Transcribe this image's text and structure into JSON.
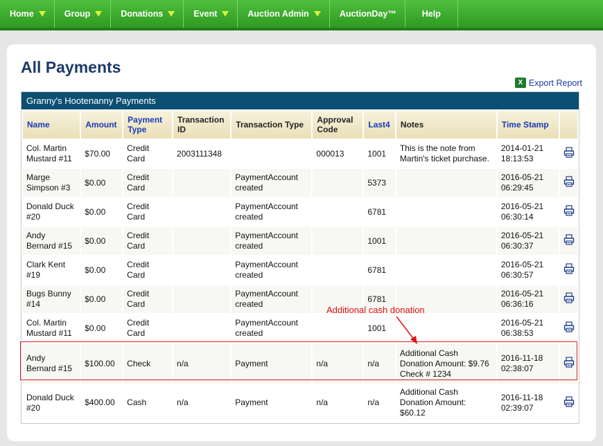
{
  "nav": {
    "items": [
      {
        "label": "Home",
        "dropdown": true
      },
      {
        "label": "Group",
        "dropdown": true
      },
      {
        "label": "Donations",
        "dropdown": true
      },
      {
        "label": "Event",
        "dropdown": true
      },
      {
        "label": "Auction Admin",
        "dropdown": true
      },
      {
        "label": "AuctionDay™",
        "dropdown": false
      },
      {
        "label": "Help",
        "dropdown": false
      }
    ]
  },
  "page": {
    "title": "All Payments",
    "export_label": "Export Report"
  },
  "table": {
    "title": "Granny's Hootenanny Payments",
    "headers": [
      {
        "label": "Name",
        "sortable": true
      },
      {
        "label": "Amount",
        "sortable": true
      },
      {
        "label": "Payment Type",
        "sortable": true
      },
      {
        "label": "Transaction ID",
        "sortable": false
      },
      {
        "label": "Transaction Type",
        "sortable": false
      },
      {
        "label": "Approval Code",
        "sortable": false
      },
      {
        "label": "Last4",
        "sortable": true
      },
      {
        "label": "Notes",
        "sortable": false
      },
      {
        "label": "Time Stamp",
        "sortable": true
      }
    ],
    "rows": [
      {
        "name": "Col. Martin Mustard #11",
        "amount": "$70.00",
        "payment_type": "Credit Card",
        "transaction_id": "2003111348",
        "transaction_type": "",
        "approval_code": "000013",
        "last4": "1001",
        "notes": "This is the note from Martin's ticket purchase.",
        "time_stamp": "2014-01-21 18:13:53"
      },
      {
        "name": "Marge Simpson #3",
        "amount": "$0.00",
        "payment_type": "Credit Card",
        "transaction_id": "",
        "transaction_type": "PaymentAccount created",
        "approval_code": "",
        "last4": "5373",
        "notes": "",
        "time_stamp": "2016-05-21 06:29:45"
      },
      {
        "name": "Donald Duck #20",
        "amount": "$0.00",
        "payment_type": "Credit Card",
        "transaction_id": "",
        "transaction_type": "PaymentAccount created",
        "approval_code": "",
        "last4": "6781",
        "notes": "",
        "time_stamp": "2016-05-21 06:30:14"
      },
      {
        "name": "Andy Bernard #15",
        "amount": "$0.00",
        "payment_type": "Credit Card",
        "transaction_id": "",
        "transaction_type": "PaymentAccount created",
        "approval_code": "",
        "last4": "1001",
        "notes": "",
        "time_stamp": "2016-05-21 06:30:37"
      },
      {
        "name": "Clark Kent #19",
        "amount": "$0.00",
        "payment_type": "Credit Card",
        "transaction_id": "",
        "transaction_type": "PaymentAccount created",
        "approval_code": "",
        "last4": "6781",
        "notes": "",
        "time_stamp": "2016-05-21 06:30:57"
      },
      {
        "name": "Bugs Bunny #14",
        "amount": "$0.00",
        "payment_type": "Credit Card",
        "transaction_id": "",
        "transaction_type": "PaymentAccount created",
        "approval_code": "",
        "last4": "6781",
        "notes": "",
        "time_stamp": "2016-05-21 06:36:16"
      },
      {
        "name": "Col. Martin Mustard #11",
        "amount": "$0.00",
        "payment_type": "Credit Card",
        "transaction_id": "",
        "transaction_type": "PaymentAccount created",
        "approval_code": "",
        "last4": "1001",
        "notes": "",
        "time_stamp": "2016-05-21 06:38:53"
      },
      {
        "name": "Andy Bernard #15",
        "amount": "$100.00",
        "payment_type": "Check",
        "transaction_id": "n/a",
        "transaction_type": "Payment",
        "approval_code": "n/a",
        "last4": "n/a",
        "notes": "Additional Cash Donation Amount: $9.76 Check # 1234",
        "time_stamp": "2016-11-18 02:38:07"
      },
      {
        "name": "Donald Duck #20",
        "amount": "$400.00",
        "payment_type": "Cash",
        "transaction_id": "n/a",
        "transaction_type": "Payment",
        "approval_code": "n/a",
        "last4": "n/a",
        "notes": "Additional Cash Donation Amount: $60.12",
        "time_stamp": "2016-11-18 02:39:07"
      }
    ]
  },
  "annotation": {
    "text": "Additional cash donation",
    "color": "#e01010"
  },
  "colors": {
    "nav_green": "#2e9a22",
    "table_title_bg": "#0d4f72",
    "link_blue": "#1a3ab8"
  },
  "icons": [
    "chevron-down-icon",
    "excel-icon",
    "print-icon"
  ]
}
